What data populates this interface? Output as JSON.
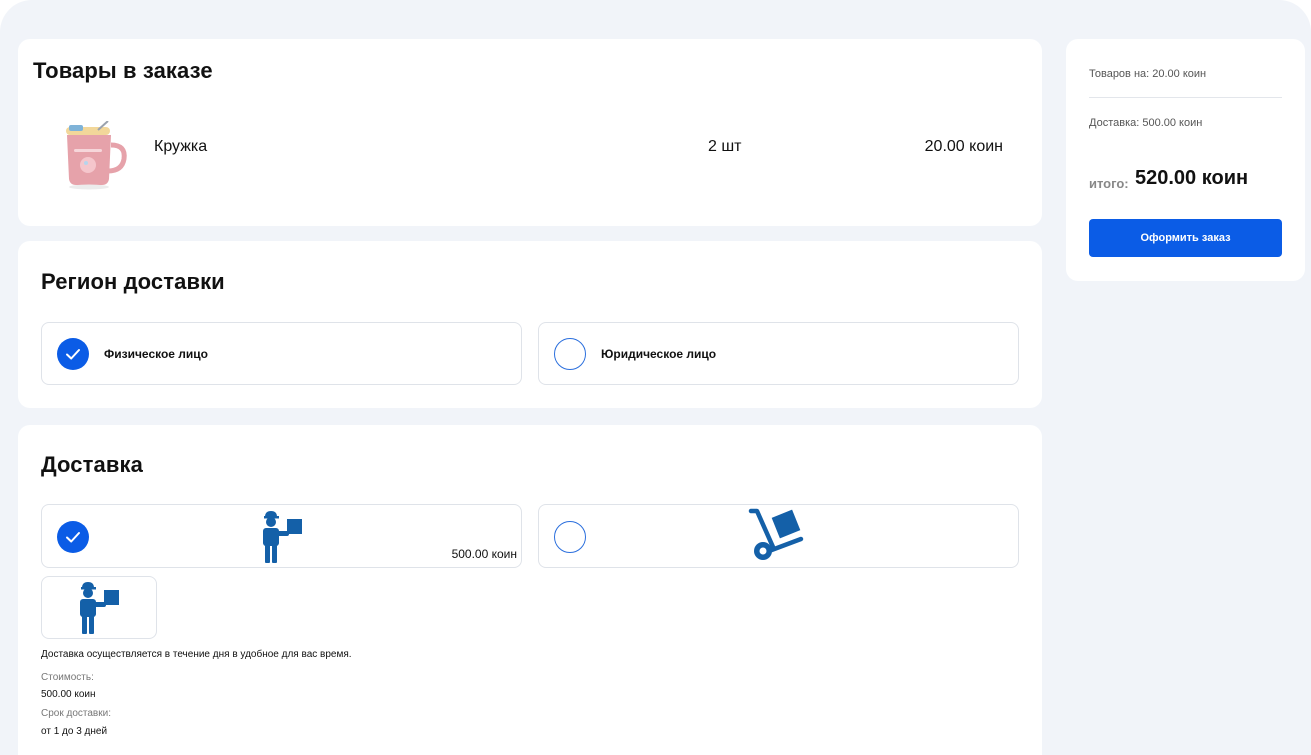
{
  "items_section": {
    "title": "Товары в заказе",
    "items": [
      {
        "name": "Кружка",
        "quantity": "2 шт",
        "price": "20.00 коин",
        "image": "pink-mug"
      }
    ]
  },
  "region_section": {
    "title": "Регион доставки",
    "options": [
      {
        "label": "Физическое лицо",
        "selected": true
      },
      {
        "label": "Юридическое лицо",
        "selected": false
      }
    ]
  },
  "delivery_section": {
    "title": "Доставка",
    "options": [
      {
        "icon": "courier-icon",
        "price": "500.00 коин",
        "selected": true
      },
      {
        "icon": "hand-truck-icon",
        "price": "",
        "selected": false
      }
    ],
    "details": {
      "icon": "courier-icon",
      "description": "Доставка осуществляется в течение дня в удобное для вас время.",
      "cost_label": "Стоимость:",
      "cost_value": "500.00 коин",
      "term_label": "Срок доставки:",
      "term_value": "от 1 до 3 дней"
    }
  },
  "summary": {
    "goods": "Товаров на: 20.00 коин",
    "delivery": "Доставка: 500.00 коин",
    "total_label": "итого:",
    "total_value": "520.00 коин",
    "order_button": "Оформить заказ"
  },
  "colors": {
    "accent": "#0b5ce6",
    "icon_blue": "#1460a8",
    "page_bg": "#f1f4f9",
    "mug_pink": "#e6a2aa"
  }
}
